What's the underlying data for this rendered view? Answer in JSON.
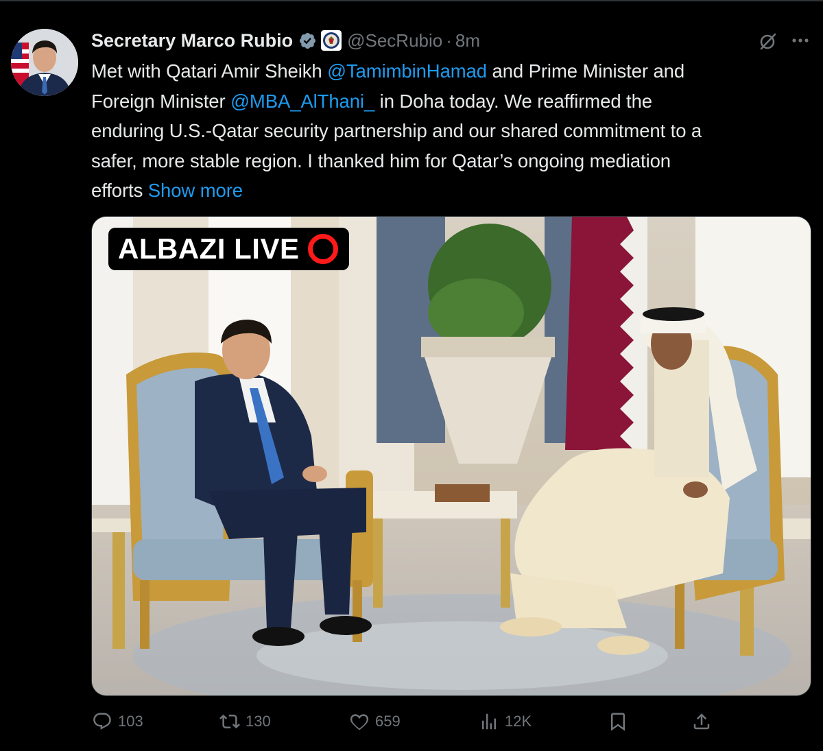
{
  "tweet": {
    "author_name": "Secretary Marco Rubio",
    "handle": "@SecRubio",
    "separator": "·",
    "time_ago": "8m",
    "text_lines": [
      [
        "Met with Qatari Amir Sheikh ",
        "@TamimbinHamad",
        " and Prime Minister and"
      ],
      [
        "Foreign Minister ",
        "@MBA_AlThani_",
        " in Doha today. We reaffirmed the"
      ],
      [
        "enduring U.S.-Qatar security partnership and our shared commitment to a"
      ],
      [
        "safer, more stable region. I thanked him for Qatar’s ongoing mediation"
      ],
      [
        "efforts ",
        "Show more"
      ]
    ],
    "show_more_label": "Show more",
    "media_overlay": {
      "badge_text": "ALBAZI LIVE"
    },
    "actions": {
      "replies": "103",
      "reposts": "130",
      "likes": "659",
      "views": "12K"
    }
  },
  "colors": {
    "background": "#000000",
    "text_primary": "#e7e9ea",
    "text_secondary": "#71767b",
    "link": "#1d9bf0",
    "verified": "#829aab",
    "live_ring": "#ff1a1a"
  },
  "icons": {
    "verified": "verified-badge-icon",
    "seal": "state-department-seal-icon",
    "grok": "grok-icon",
    "more": "more-options-icon",
    "reply": "reply-icon",
    "repost": "repost-icon",
    "like": "like-icon",
    "views": "views-icon",
    "bookmark": "bookmark-icon",
    "share": "share-icon"
  }
}
